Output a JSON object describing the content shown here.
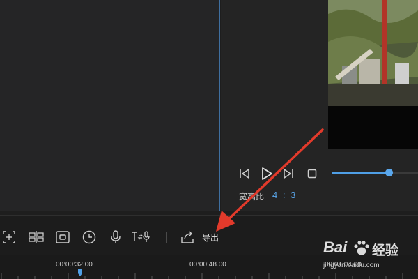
{
  "preview": {
    "aspect_label": "宽高比",
    "aspect_value": "4 : 3",
    "volume_level": 0.67
  },
  "toolbar": {
    "export_label": "导出",
    "tools": [
      "crop-icon",
      "split-icon",
      "record-screen-icon",
      "speed-clock-icon",
      "voiceover-mic-icon",
      "text-to-speech-icon"
    ]
  },
  "timeline": {
    "timecodes": [
      "00:00:32.00",
      "00:00:48.00",
      "00:01:04.00"
    ]
  },
  "watermark": {
    "brand": "Bai",
    "brand_tail": "经验",
    "site": "jingyan.baidu.com"
  },
  "colors": {
    "accent": "#4f9fe6",
    "annotation_arrow": "#e23a2b"
  }
}
